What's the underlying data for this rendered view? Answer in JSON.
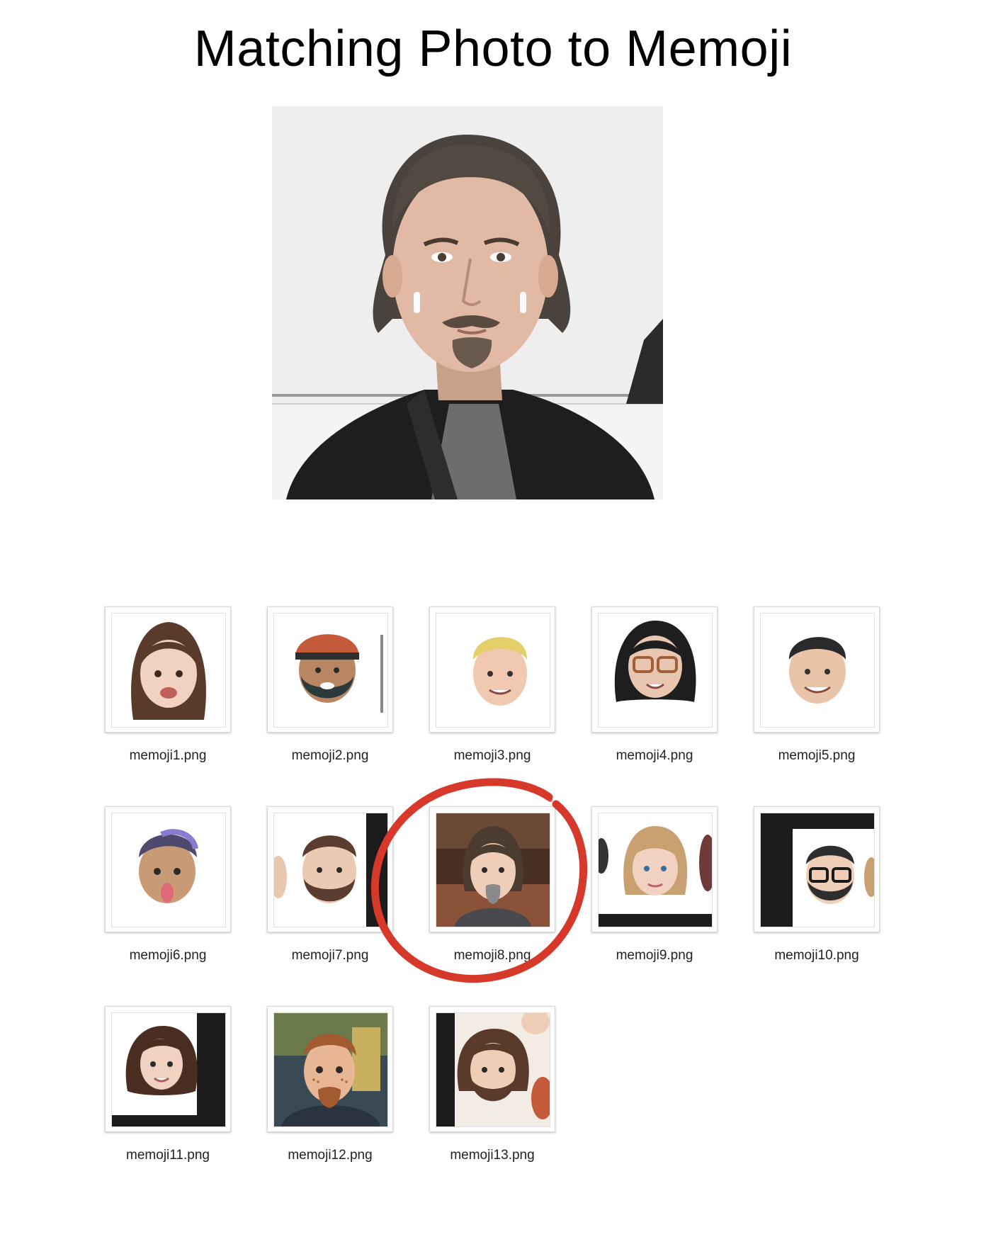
{
  "page": {
    "title": "Matching Photo to Memoji"
  },
  "files": [
    {
      "name": "memoji1.png",
      "icon": "memoji-woman-long-brown-hair"
    },
    {
      "name": "memoji2.png",
      "icon": "memoji-man-cap-beard"
    },
    {
      "name": "memoji3.png",
      "icon": "memoji-man-blond-hair"
    },
    {
      "name": "memoji4.png",
      "icon": "memoji-woman-glasses"
    },
    {
      "name": "memoji5.png",
      "icon": "memoji-man-short-dark-hair"
    },
    {
      "name": "memoji6.png",
      "icon": "memoji-purple-hair-tongue"
    },
    {
      "name": "memoji7.png",
      "icon": "memoji-man-brown-beard"
    },
    {
      "name": "memoji8.png",
      "icon": "memoji-man-long-hair-goatee",
      "highlighted": true
    },
    {
      "name": "memoji9.png",
      "icon": "memoji-woman-blonde-bob"
    },
    {
      "name": "memoji10.png",
      "icon": "memoji-man-glasses-beard"
    },
    {
      "name": "memoji11.png",
      "icon": "memoji-woman-brown-wavy-hair"
    },
    {
      "name": "memoji12.png",
      "icon": "memoji-man-ginger-freckles"
    },
    {
      "name": "memoji13.png",
      "icon": "memoji-long-hair-beard"
    }
  ],
  "colors": {
    "highlight_circle": "#d6382a"
  }
}
